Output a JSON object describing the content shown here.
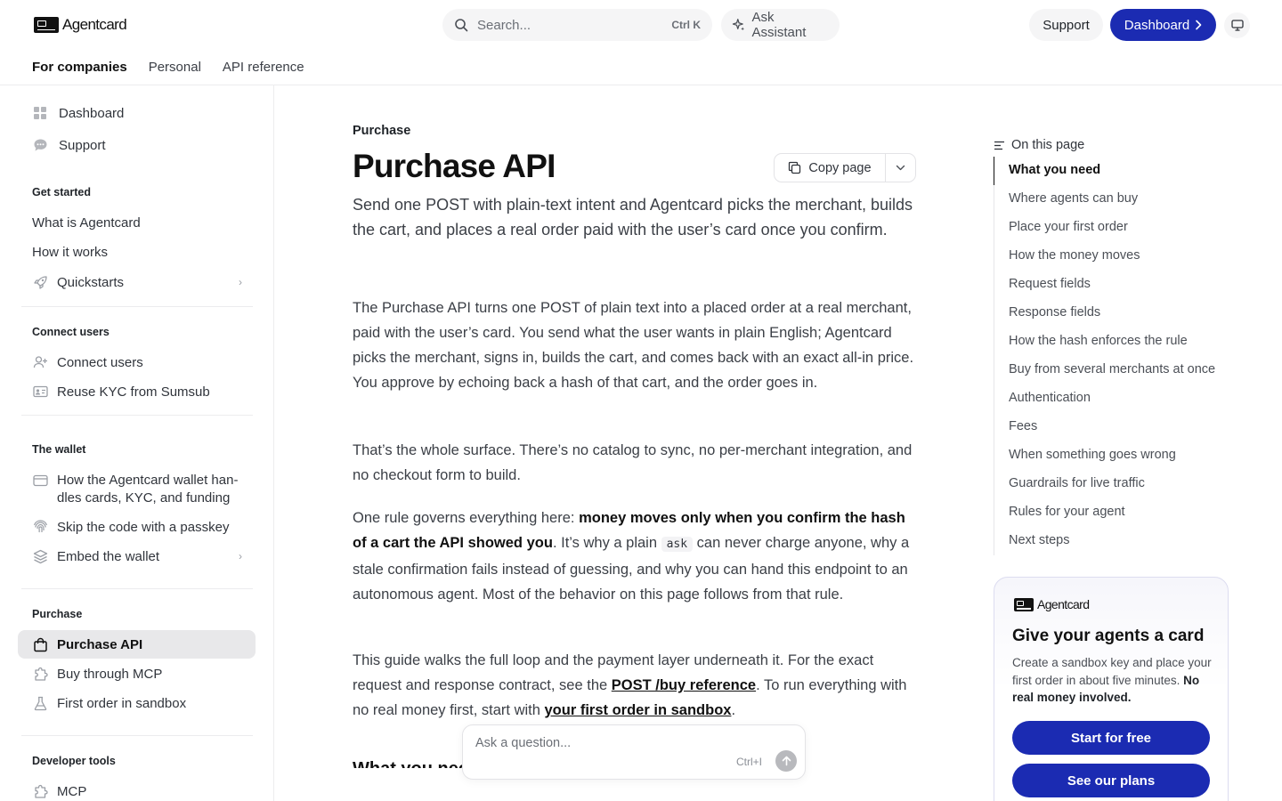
{
  "header": {
    "logo_text": "Agentcard",
    "search_placeholder": "Search...",
    "search_shortcut": "Ctrl K",
    "ask_assistant": "Ask Assistant",
    "support": "Support",
    "dashboard": "Dashboard"
  },
  "tabs": [
    "For companies",
    "Personal",
    "API reference"
  ],
  "sidebar": {
    "top": [
      {
        "label": "Dashboard",
        "icon": "grid-icon"
      },
      {
        "label": "Support",
        "icon": "chat-icon"
      }
    ],
    "get_started": {
      "heading": "Get started",
      "items": [
        "What is Agentcard",
        "How it works",
        "Quickstarts"
      ]
    },
    "connect_users": {
      "heading": "Connect users",
      "items": [
        "Connect users",
        "Reuse KYC from Sumsub"
      ]
    },
    "wallet": {
      "heading": "The wallet",
      "items": [
        "How the Agentcard wallet han-",
        "dles cards, KYC, and funding",
        "Skip the code with a passkey",
        "Embed the wallet"
      ]
    },
    "purchase": {
      "heading": "Purchase",
      "items": [
        "Purchase API",
        "Buy through MCP",
        "First order in sandbox"
      ]
    },
    "developer_tools": {
      "heading": "Developer tools",
      "items": [
        "MCP"
      ]
    }
  },
  "main": {
    "eyebrow": "Purchase",
    "title": "Purchase API",
    "copy_page": "Copy page",
    "lead": "Send one POST with plain-text intent and Agentcard picks the merchant, builds the cart, and places a real order paid with the user’s card once you confirm.",
    "p1": "The Purchase API turns one POST of plain text into a placed order at a real merchant, paid with the user’s card. You send what the user wants in plain English; Agentcard picks the merchant, signs in, builds the cart, and comes back with an exact all-in price. You approve by echoing back a hash of that cart, and the order goes in.",
    "p2": "That’s the whole surface. There’s no catalog to sync, no per-merchant integration, and no checkout form to build.",
    "p3_a": "One rule governs everything here: ",
    "p3_b": "money moves only when you confirm the hash of a cart the API showed you",
    "p3_c": ". It’s why a plain ",
    "p3_code": "ask",
    "p3_d": " can never charge anyone, why a stale confirmation fails instead of guessing, and why you can hand this endpoint to an autonomous agent. Most of the behavior on this page follows from that rule.",
    "p4_a": "This guide walks the full loop and the payment layer underneath it. For the exact request and response contract, see the ",
    "p4_link1": "POST /buy reference",
    "p4_b": ". To run everything with no real money first, start with ",
    "p4_link2": "your first order in sandbox",
    "p4_c": ".",
    "next_heading": "What you need"
  },
  "ask_box": {
    "placeholder": "Ask a question...",
    "shortcut": "Ctrl+I"
  },
  "toc": {
    "heading": "On this page",
    "items": [
      "What you need",
      "Where agents can buy",
      "Place your first order",
      "How the money moves",
      "Request fields",
      "Response fields",
      "How the hash enforces the rule",
      "Buy from several merchants at once",
      "Authentication",
      "Fees",
      "When something goes wrong",
      "Guardrails for live traffic",
      "Rules for your agent",
      "Next steps"
    ]
  },
  "promo": {
    "logo_text": "Agentcard",
    "title": "Give your agents a card",
    "desc": "Create a sandbox key and place your first order in about five minutes.",
    "desc_bold": "No real money involved.",
    "btn1": "Start for free",
    "btn2": "See our plans"
  },
  "colors": {
    "accent": "#1b2bb2",
    "active_bg": "#e8e8ea"
  }
}
